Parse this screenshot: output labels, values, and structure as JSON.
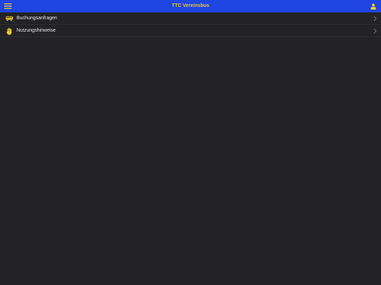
{
  "header": {
    "title": "TTC Vereinsbus",
    "menu_icon": "hamburger-menu-icon",
    "user_icon": "user-icon",
    "accent_color": "#f2cc2a",
    "bar_color": "#1f45e2"
  },
  "list": {
    "items": [
      {
        "label": "Buchungsanfragen",
        "icon": "bus-icon"
      },
      {
        "label": "Nutzungshinweise",
        "icon": "hand-icon"
      }
    ]
  }
}
